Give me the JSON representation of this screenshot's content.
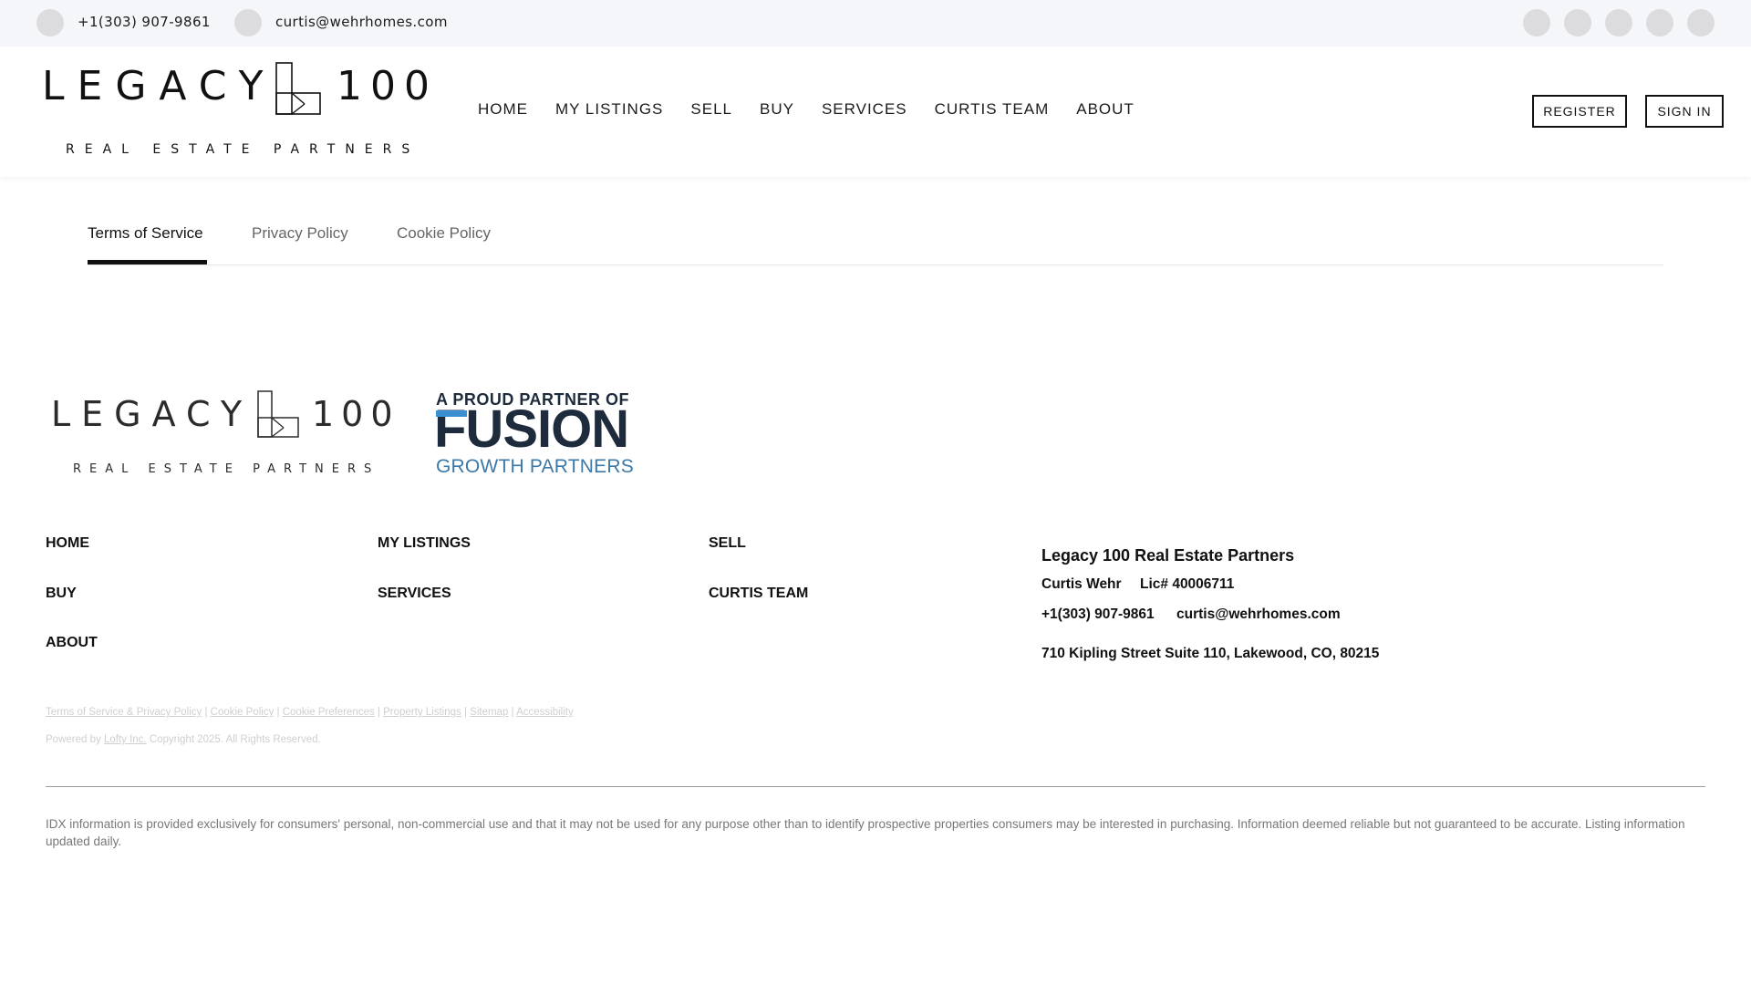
{
  "topbar": {
    "phone": "+1(303) 907-9861",
    "email": "curtis@wehrhomes.com",
    "phone_icon": "phone-icon",
    "email_icon": "email-icon",
    "social_icons": [
      "facebook-icon",
      "instagram-icon",
      "linkedin-icon",
      "youtube-icon",
      "twitter-icon"
    ]
  },
  "brand": {
    "name_left": "LEGACY",
    "name_right": "100",
    "tagline": "REAL ESTATE PARTNERS"
  },
  "nav": {
    "items": [
      "HOME",
      "MY LISTINGS",
      "SELL",
      "BUY",
      "SERVICES",
      "CURTIS TEAM",
      "ABOUT"
    ],
    "register_label": "REGISTER",
    "signin_label": "SIGN IN"
  },
  "tabs": {
    "items": [
      "Terms of Service",
      "Privacy Policy",
      "Cookie Policy"
    ],
    "active": "Terms of Service"
  },
  "partner": {
    "line1": "A PROUD PARTNER OF",
    "line2": "FUSION",
    "line3": "GROWTH PARTNERS"
  },
  "footer_nav": {
    "items": [
      "HOME",
      "MY LISTINGS",
      "SELL",
      "BUY",
      "SERVICES",
      "CURTIS TEAM",
      "ABOUT"
    ]
  },
  "contact": {
    "company": "Legacy 100 Real Estate Partners",
    "agent": "Curtis Wehr",
    "license": "Lic# 40006711",
    "phone": "+1(303) 907-9861",
    "email": "curtis@wehrhomes.com",
    "address": "710 Kipling Street Suite 110, Lakewood, CO, 80215"
  },
  "legal": {
    "links": [
      "Terms of Service & Privacy Policy",
      "Cookie Policy",
      "Cookie Preferences",
      "Property Listings",
      "Sitemap",
      "Accessibility"
    ],
    "powered_prefix": "Powered by",
    "powered_link": "Lofty Inc.",
    "copyright": "Copyright 2025. All Rights Reserved."
  },
  "idx_text": "IDX information is provided exclusively for consumers' personal, non-commercial use and that it may not be used for any purpose other than to identify prospective properties consumers may be interested in purchasing. Information deemed reliable but not guaranteed to be accurate. Listing information updated daily.",
  "colors": {
    "topbar_bg": "#f5f6f9",
    "fusion_navy": "#1e2b3c",
    "fusion_blue": "#3a8fd0"
  }
}
